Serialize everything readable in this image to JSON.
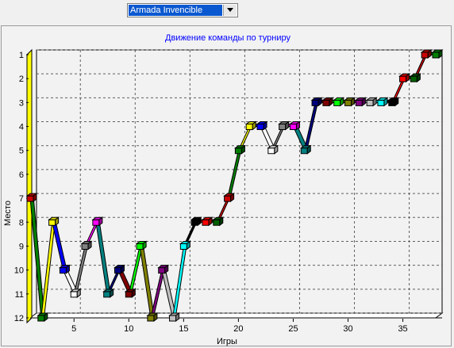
{
  "selector": {
    "value": "Armada Invencible",
    "icon": "chevron-down-icon"
  },
  "chart_data": {
    "type": "line",
    "title": "Движение команды по турниру",
    "xlabel": "Игры",
    "ylabel": "Место",
    "xlim": [
      1,
      38
    ],
    "ylim": [
      12,
      1
    ],
    "y_inverted": true,
    "grid": true,
    "x_ticks": [
      5,
      10,
      15,
      20,
      25,
      30,
      35
    ],
    "y_ticks": [
      1,
      2,
      3,
      4,
      5,
      6,
      7,
      8,
      9,
      10,
      11,
      12
    ],
    "points": [
      {
        "game": 1,
        "place": 7
      },
      {
        "game": 2,
        "place": 12
      },
      {
        "game": 3,
        "place": 8
      },
      {
        "game": 4,
        "place": 10
      },
      {
        "game": 5,
        "place": 11
      },
      {
        "game": 6,
        "place": 9
      },
      {
        "game": 7,
        "place": 8
      },
      {
        "game": 8,
        "place": 11
      },
      {
        "game": 9,
        "place": 10
      },
      {
        "game": 10,
        "place": 11
      },
      {
        "game": 11,
        "place": 9
      },
      {
        "game": 12,
        "place": 12
      },
      {
        "game": 13,
        "place": 10
      },
      {
        "game": 14,
        "place": 12
      },
      {
        "game": 15,
        "place": 9
      },
      {
        "game": 16,
        "place": 8
      },
      {
        "game": 17,
        "place": 8
      },
      {
        "game": 18,
        "place": 8
      },
      {
        "game": 19,
        "place": 7
      },
      {
        "game": 20,
        "place": 5
      },
      {
        "game": 21,
        "place": 4
      },
      {
        "game": 22,
        "place": 4
      },
      {
        "game": 23,
        "place": 5
      },
      {
        "game": 24,
        "place": 4
      },
      {
        "game": 25,
        "place": 4
      },
      {
        "game": 26,
        "place": 5
      },
      {
        "game": 27,
        "place": 3
      },
      {
        "game": 28,
        "place": 3
      },
      {
        "game": 29,
        "place": 3
      },
      {
        "game": 30,
        "place": 3
      },
      {
        "game": 31,
        "place": 3
      },
      {
        "game": 32,
        "place": 3
      },
      {
        "game": 33,
        "place": 3
      },
      {
        "game": 34,
        "place": 3
      },
      {
        "game": 35,
        "place": 2
      },
      {
        "game": 36,
        "place": 2
      },
      {
        "game": 37,
        "place": 1
      },
      {
        "game": 38,
        "place": 1
      }
    ],
    "colors": {
      "title": "#0000ff",
      "wall_left": "#ffff00",
      "grid": "#606060",
      "palette": [
        "#cc0000",
        "#008000",
        "#ffff00",
        "#0000ff",
        "#ffffff",
        "#808080",
        "#ff00ff",
        "#008080",
        "#000080",
        "#800000",
        "#00ff00",
        "#808000",
        "#800080",
        "#c0c0c0",
        "#00ffff",
        "#000000",
        "#ff0000",
        "#006000"
      ]
    }
  }
}
